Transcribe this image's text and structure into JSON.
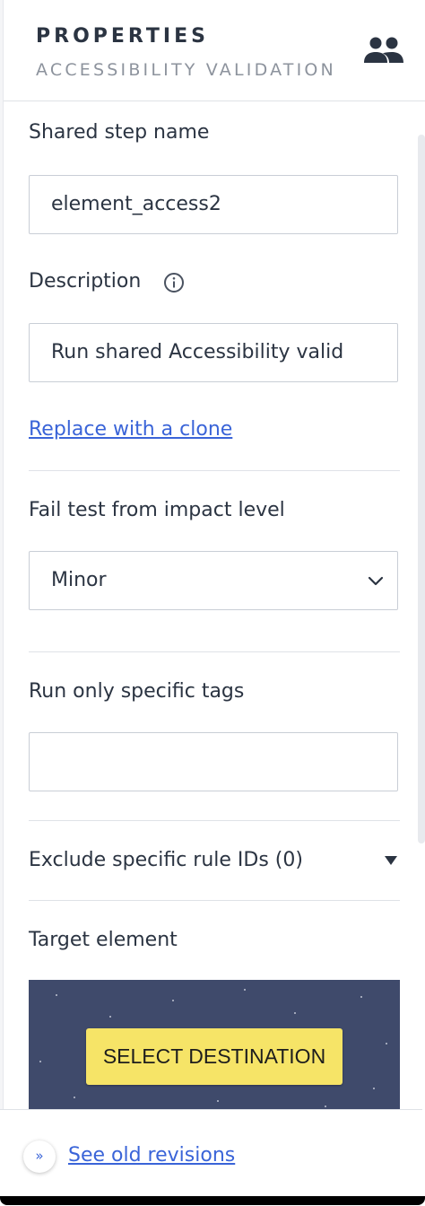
{
  "header": {
    "title": "PROPERTIES",
    "subtitle": "ACCESSIBILITY VALIDATION",
    "icon": "people-icon"
  },
  "shared_step": {
    "label": "Shared step name",
    "value": "element_access2"
  },
  "description": {
    "label": "Description",
    "info_icon": "info-icon",
    "value": "Run shared Accessibility valid"
  },
  "replace_link": "Replace with a clone",
  "impact": {
    "label": "Fail test from impact level",
    "selected": "Minor",
    "icon": "chevron-down-icon"
  },
  "tags": {
    "label": "Run only specific tags",
    "value": ""
  },
  "exclude": {
    "label": "Exclude specific rule IDs (0)",
    "icon": "caret-down-icon"
  },
  "target": {
    "label": "Target element",
    "button": "SELECT DESTINATION"
  },
  "footer": {
    "icon": "double-chevron-right-icon",
    "icon_glyph": "»",
    "link": "See old revisions"
  },
  "colors": {
    "accent": "#3a64d8",
    "button": "#f6e467",
    "target_bg": "#3f4a6b",
    "text": "#2b3442",
    "muted": "#8d939d"
  }
}
